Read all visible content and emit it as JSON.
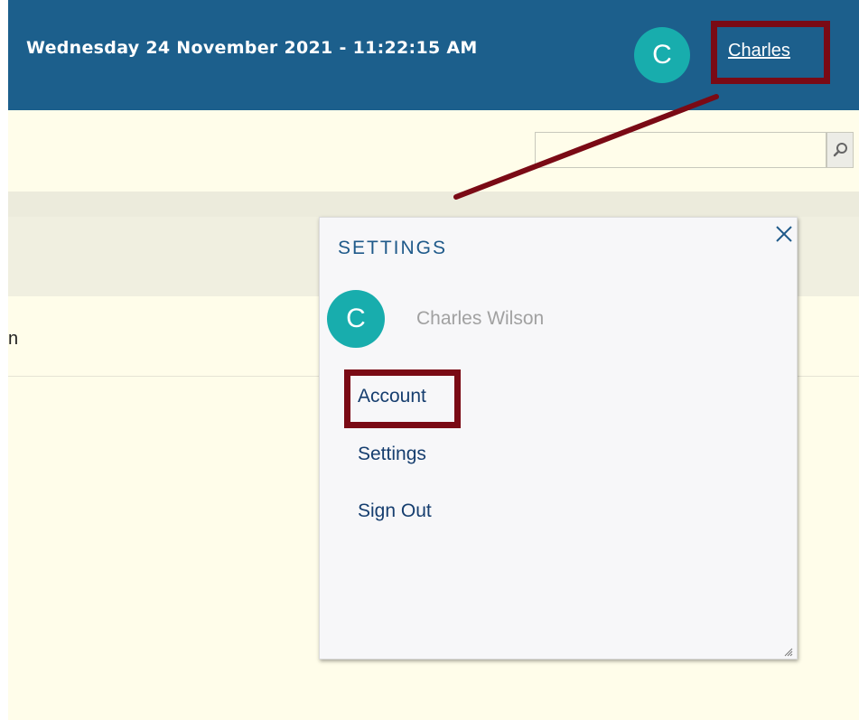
{
  "header": {
    "datetime": "Wednesday 24 November 2021 - 11:22:15 AM",
    "avatar_initial": "C",
    "user_link": "Charles"
  },
  "content": {
    "row_text": "n"
  },
  "settings_popup": {
    "title": "SETTINGS",
    "avatar_initial": "C",
    "full_name": "Charles Wilson",
    "menu": {
      "account": "Account",
      "settings": "Settings",
      "sign_out": "Sign Out"
    }
  },
  "colors": {
    "header_bg": "#1c5f8c",
    "page_bg": "#fffdea",
    "avatar": "#18adad",
    "highlight": "#7a0a15",
    "menu_link": "#163e6f"
  },
  "icons": {
    "search": "search-icon",
    "close": "close-icon",
    "resize": "resize-grip-icon"
  }
}
